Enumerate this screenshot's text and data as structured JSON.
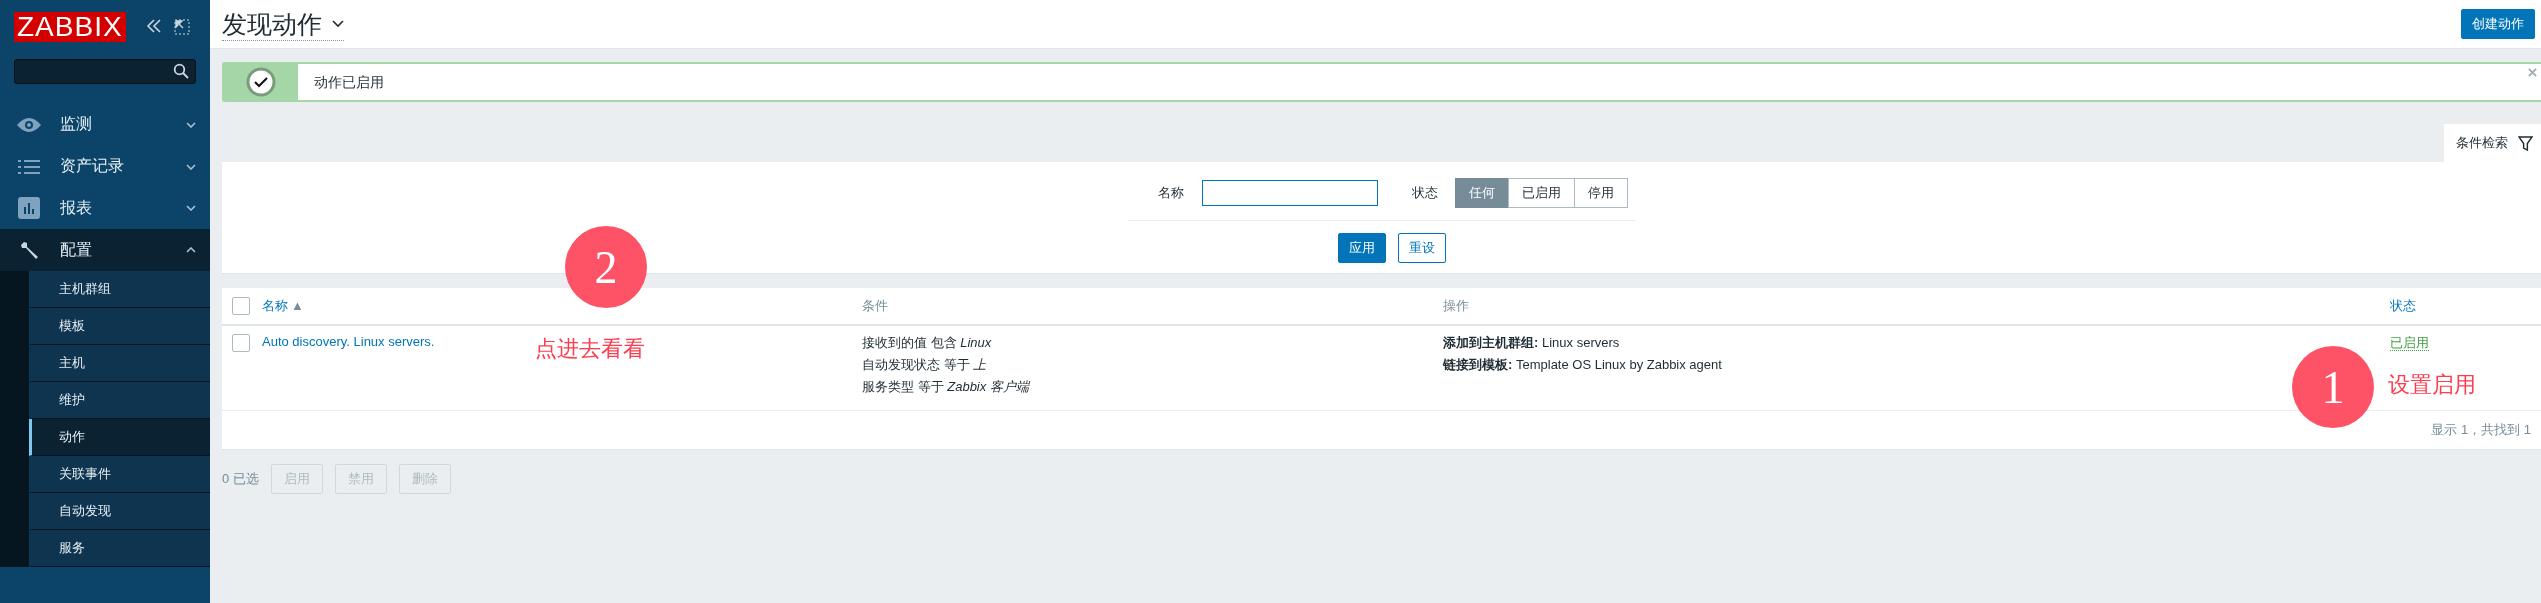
{
  "sidebar": {
    "logo": "ZABBIX",
    "items": [
      {
        "label": "监测",
        "expanded": false
      },
      {
        "label": "资产记录",
        "expanded": false
      },
      {
        "label": "报表",
        "expanded": false
      },
      {
        "label": "配置",
        "expanded": true,
        "children": [
          {
            "label": "主机群组",
            "selected": false
          },
          {
            "label": "模板",
            "selected": false
          },
          {
            "label": "主机",
            "selected": false
          },
          {
            "label": "维护",
            "selected": false
          },
          {
            "label": "动作",
            "selected": true
          },
          {
            "label": "关联事件",
            "selected": false
          },
          {
            "label": "自动发现",
            "selected": false
          },
          {
            "label": "服务",
            "selected": false
          }
        ]
      }
    ]
  },
  "header": {
    "title": "发现动作",
    "create_button": "创建动作"
  },
  "message": {
    "text": "动作已启用"
  },
  "filter": {
    "tab": "条件检索",
    "name_label": "名称",
    "status_label": "状态",
    "status_options": [
      {
        "label": "任何",
        "selected": true
      },
      {
        "label": "已启用",
        "selected": false
      },
      {
        "label": "停用",
        "selected": false
      }
    ],
    "apply": "应用",
    "reset": "重设"
  },
  "table": {
    "select_all_checked": false,
    "columns": [
      "名称",
      "条件",
      "操作",
      "状态"
    ],
    "sort_indicator": "▲",
    "rows": [
      {
        "checked": false,
        "name": "Auto discovery. Linux servers.",
        "conditions": [
          "接收到的值 包含 *Linux*",
          "自动发现状态 等于 *上*",
          "服务类型 等于 *Zabbix 客户端*"
        ],
        "operations": [
          "**添加到主机群组:** Linux servers",
          "**链接到模板:** Template OS Linux by Zabbix agent"
        ],
        "status": "已启用",
        "enabled": true
      }
    ],
    "footer": "显示 1，共找到 1"
  },
  "selection": {
    "count": "0 已选",
    "buttons": [
      {
        "label": "启用",
        "disabled": true
      },
      {
        "label": "禁用",
        "disabled": true
      },
      {
        "label": "删除",
        "disabled": true
      }
    ]
  },
  "annotations": [
    {
      "number": "2",
      "note": "点进去看看"
    },
    {
      "number": "1",
      "note": "设置启用"
    }
  ]
}
